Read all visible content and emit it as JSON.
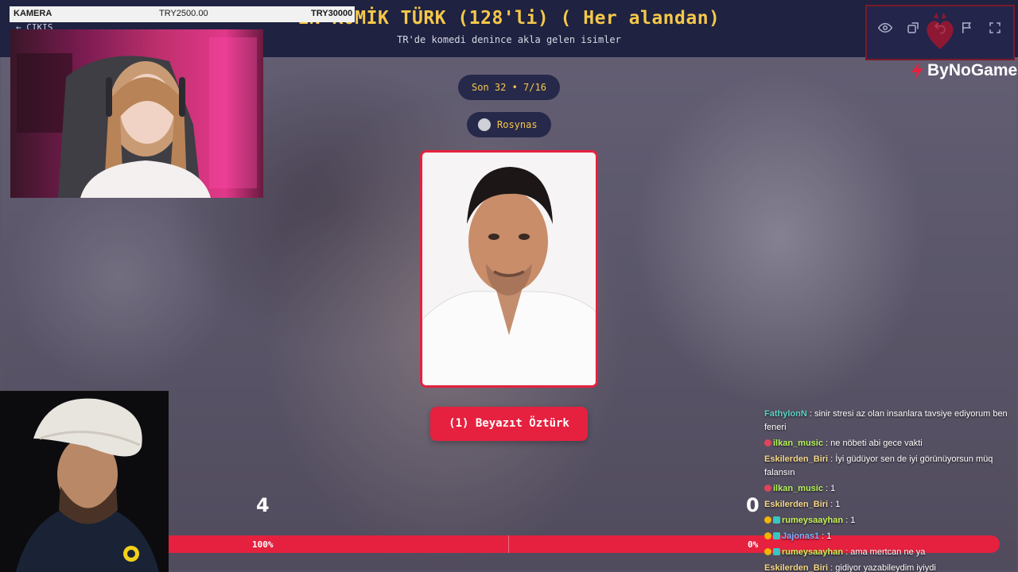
{
  "header": {
    "title": "EN KOMİK TÜRK (128'li) ( Her alandan)",
    "subtitle": "TR'de komedi denince akla gelen isimler",
    "back_label": "← ÇIKIŞ"
  },
  "donation": {
    "camera_label": "KAMERA",
    "current": "TRY2500.00",
    "goal": "TRY30000"
  },
  "toolbar": {
    "icons": [
      "eye-icon",
      "share-icon",
      "undo-icon",
      "flag-icon",
      "fullscreen-icon"
    ],
    "brand": "ByNoGame"
  },
  "round": {
    "label": "Son 32 • 7/16",
    "user": "Rosynas"
  },
  "candidate": {
    "choice_label": "(1) Beyazıt Öztürk"
  },
  "votes": {
    "left_score": "4",
    "right_score": "0",
    "left_pct": "100%",
    "right_pct": "0%",
    "left_fraction": 1.0
  },
  "chat": [
    {
      "user": "FathylonN",
      "text": " : sinir stresi az olan insanlara tavsiye ediyorum ben feneri",
      "color": "#5fd3c8",
      "badges": []
    },
    {
      "user": "ilkan_music",
      "text": " : ne nöbeti abi gece vakti",
      "color": "#b6f25b",
      "badges": [
        "red"
      ]
    },
    {
      "user": "Eskilerden_Biri",
      "text": " : İyi güdüyor sen de iyi görünüyorsun müq falansın",
      "color": "#f5d98a",
      "badges": []
    },
    {
      "user": "ilkan_music",
      "text": " : 1",
      "color": "#b6f25b",
      "badges": [
        "red"
      ]
    },
    {
      "user": "Eskilerden_Biri",
      "text": " : 1",
      "color": "#f5d98a",
      "badges": []
    },
    {
      "user": "rumeysaayhan",
      "text": " : 1",
      "color": "#c7f25b",
      "badges": [
        "yellow",
        "teal"
      ]
    },
    {
      "user": "Jajonas1",
      "text": " : 1",
      "color": "#7fb3ff",
      "badges": [
        "yellow",
        "teal"
      ]
    },
    {
      "user": "rumeysaayhan",
      "text": " : ama mertcan ne ya",
      "color": "#c7f25b",
      "badges": [
        "yellow",
        "teal"
      ]
    },
    {
      "user": "Eskilerden_Biri",
      "text": " : gidiyor yazabileydim iyiydi",
      "color": "#f5d98a",
      "badges": []
    }
  ],
  "colors": {
    "accent": "#e5213f",
    "title_gold": "#f5c84a",
    "header_bg": "#1f2240"
  }
}
